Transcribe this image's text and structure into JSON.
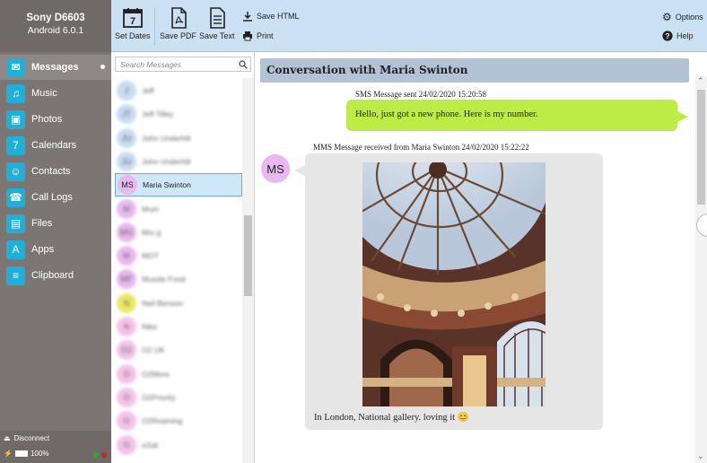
{
  "device": {
    "name": "Sony D6603",
    "os": "Android 6.0.1"
  },
  "nav": [
    {
      "label": "Messages",
      "icon": "messages-icon",
      "glyph": "✉",
      "active": true
    },
    {
      "label": "Music",
      "icon": "music-icon",
      "glyph": "♫"
    },
    {
      "label": "Photos",
      "icon": "photos-icon",
      "glyph": "▣"
    },
    {
      "label": "Calendars",
      "icon": "calendar-icon",
      "glyph": "7"
    },
    {
      "label": "Contacts",
      "icon": "contacts-icon",
      "glyph": "☺"
    },
    {
      "label": "Call Logs",
      "icon": "phone-icon",
      "glyph": "☎"
    },
    {
      "label": "Files",
      "icon": "files-icon",
      "glyph": "▤"
    },
    {
      "label": "Apps",
      "icon": "apps-icon",
      "glyph": "A"
    },
    {
      "label": "Clipboard",
      "icon": "clipboard-icon",
      "glyph": "≡"
    }
  ],
  "footer": {
    "disconnect": "Disconnect",
    "battery": "100%",
    "led1": "#2eaa3a",
    "led2": "#c0282a"
  },
  "toolbar": {
    "set_dates": "Set Dates",
    "save_pdf": "Save PDF",
    "save_text": "Save Text",
    "save_html": "Save HTML",
    "print": "Print",
    "options": "Options",
    "help": "Help",
    "calendar_day": "7"
  },
  "search": {
    "placeholder": "Search Messages"
  },
  "contacts": [
    {
      "initials": "J",
      "name": "Jeff",
      "color": "#c9dcf3",
      "blurred": true
    },
    {
      "initials": "JT",
      "name": "Jeff Tilley",
      "color": "#c9dcf3",
      "blurred": true
    },
    {
      "initials": "JU",
      "name": "John Underhill",
      "color": "#c9dcf3",
      "blurred": true
    },
    {
      "initials": "JU",
      "name": "John Underhill",
      "color": "#c9dcf3",
      "blurred": true
    },
    {
      "initials": "MS",
      "name": "Maria Swinton",
      "color": "#e8b8f0",
      "blurred": false,
      "selected": true
    },
    {
      "initials": "M",
      "name": "Mum",
      "color": "#e8b8f0",
      "blurred": true
    },
    {
      "initials": "MG",
      "name": "Mrs g",
      "color": "#e8b8f0",
      "blurred": true
    },
    {
      "initials": "M",
      "name": "MOT",
      "color": "#e8b8f0",
      "blurred": true
    },
    {
      "initials": "MF",
      "name": "Mussle Food",
      "color": "#e8b8f0",
      "blurred": true
    },
    {
      "initials": "N",
      "name": "Neil Benson",
      "color": "#e8e866",
      "blurred": true
    },
    {
      "initials": "N",
      "name": "Nike",
      "color": "#f5c2e8",
      "blurred": true
    },
    {
      "initials": "O2",
      "name": "O2 UK",
      "color": "#f5c2e8",
      "blurred": true
    },
    {
      "initials": "O",
      "name": "O2More",
      "color": "#f5c2e8",
      "blurred": true
    },
    {
      "initials": "O",
      "name": "O2Priority",
      "color": "#f5c2e8",
      "blurred": true
    },
    {
      "initials": "O",
      "name": "O2Roaming",
      "color": "#f5c2e8",
      "blurred": true
    },
    {
      "initials": "O",
      "name": "o2uk",
      "color": "#f5c2e8",
      "blurred": true
    }
  ],
  "conversation": {
    "title": "Conversation with Maria Swinton",
    "sent_meta": "SMS Message sent 24/02/2020 15:20:58",
    "sent_text": "Hello, just got a new phone. Here is my number.",
    "recv_meta": "MMS Message received from Maria Swinton 24/02/2020 15:22:22",
    "recv_avatar": "MS",
    "recv_caption": "In London, National gallery. loving it 😊"
  },
  "colors": {
    "sidebar": "#7b7674",
    "toolbar": "#c9e1f3",
    "sent_bubble": "#bdec45",
    "received_bubble": "#e6e6e6",
    "header": "#b3c3d6",
    "accent": "#1eb0d8"
  }
}
